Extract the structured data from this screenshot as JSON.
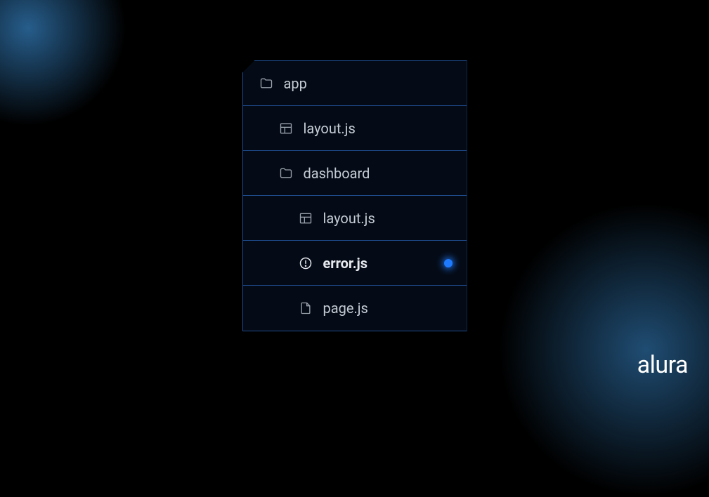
{
  "brand": "alura",
  "tree": {
    "items": [
      {
        "label": "app",
        "icon": "folder",
        "depth": 0,
        "bold": false,
        "dot": false
      },
      {
        "label": "layout.js",
        "icon": "layout",
        "depth": 1,
        "bold": false,
        "dot": false
      },
      {
        "label": "dashboard",
        "icon": "folder",
        "depth": 1,
        "bold": false,
        "dot": false
      },
      {
        "label": "layout.js",
        "icon": "layout",
        "depth": 2,
        "bold": false,
        "dot": false
      },
      {
        "label": "error.js",
        "icon": "alert",
        "depth": 2,
        "bold": true,
        "dot": true
      },
      {
        "label": "page.js",
        "icon": "file",
        "depth": 2,
        "bold": false,
        "dot": false
      }
    ]
  }
}
